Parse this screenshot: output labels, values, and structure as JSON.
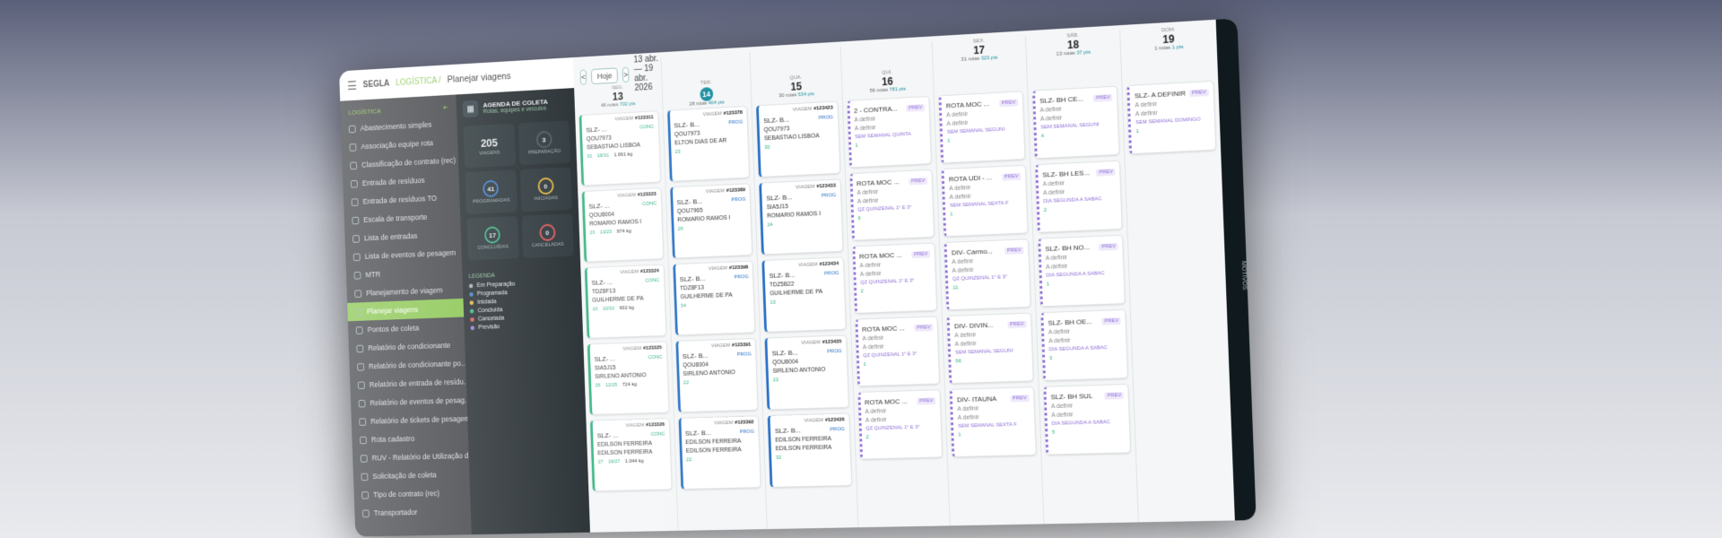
{
  "header": {
    "brand": "SEGLA",
    "module": "LOGÍSTICA /",
    "page": "Planejar viagens"
  },
  "sidebar": {
    "section": "LOGÍSTICA",
    "items": [
      "Abastecimento simples",
      "Associação equipe rota",
      "Classificação de contrato (rec)",
      "Entrada de resíduos",
      "Entrada de resíduos TO",
      "Escala de transporte",
      "Lista de entradas",
      "Lista de eventos de pesagem",
      "MTR",
      "Planejamento de viagem",
      "Planejar viagens",
      "Pontos de coleta",
      "Relatório de condicionante",
      "Relatório de condicionante po...",
      "Relatório de entrada de resídu...",
      "Relatório de eventos de pesag...",
      "Relatório de tickets de pesagem",
      "Rota cadastro",
      "RUV - Relatório de Utilização d...",
      "Solicitação de coleta",
      "Tipo de contrato (rec)",
      "Transportador"
    ]
  },
  "panel": {
    "title": "AGENDA DE COLETA",
    "subtitle": "Rotas, equipes e veículos",
    "stats": {
      "viagens": {
        "value": "205",
        "label": "VIAGENS"
      },
      "preparacao": {
        "value": "3",
        "label": "PREPARAÇÃO"
      },
      "programadas": {
        "value": "41",
        "pct": "20%",
        "label": "PROGRAMADAS"
      },
      "iniciadas": {
        "value": "0",
        "pct": "0%",
        "label": "INICIADAS"
      },
      "concluidas": {
        "value": "17",
        "pct": "8%",
        "label": "CONCLUÍDAS"
      },
      "canceladas": {
        "value": "0",
        "pct": "0%",
        "label": "CANCELADAS"
      }
    },
    "legend_title": "LEGENDA",
    "legend": [
      "Em Preparação",
      "Programada",
      "Iniciada",
      "Concluída",
      "Cancelada",
      "Previsão"
    ],
    "legend_colors": [
      "#9aa3a8",
      "#2b72c8",
      "#e0b12b",
      "#29b07a",
      "#e04848",
      "#8d6fd6"
    ]
  },
  "calendar": {
    "prev": "<",
    "today": "Hoje",
    "next": ">",
    "range": "13 abr. — 19 abr. 2026",
    "days": [
      {
        "w": "SEG.",
        "n": "13",
        "rotas": "46 rotas",
        "pts": "702 pts"
      },
      {
        "w": "TER.",
        "n": "14",
        "rotas": "28 rotas",
        "pts": "404 pts"
      },
      {
        "w": "QUA.",
        "n": "15",
        "rotas": "30 rotas",
        "pts": "534 pts"
      },
      {
        "w": "QUI.",
        "n": "16",
        "rotas": "56 rotas",
        "pts": "781 pts"
      },
      {
        "w": "SEX.",
        "n": "17",
        "rotas": "31 rotas",
        "pts": "323 pts"
      },
      {
        "w": "SÁB.",
        "n": "18",
        "rotas": "13 rotas",
        "pts": "37 pts"
      },
      {
        "w": "DOM.",
        "n": "19",
        "rotas": "1 rotas",
        "pts": "1 pts"
      }
    ],
    "mon": [
      {
        "id": "#123311",
        "route": "SLZ- ...",
        "tag": "CONC",
        "plate": "QOU7973",
        "driver": "SEBASTIÃO LISBOA",
        "f1": "31",
        "f2": "18/31",
        "w": "1.691 kg"
      },
      {
        "id": "#123323",
        "route": "SLZ- ...",
        "tag": "CONC",
        "plate": "QOU8004",
        "driver": "ROMARIO RAMOS I",
        "f1": "23",
        "f2": "13/23",
        "w": "974 kg"
      },
      {
        "id": "#123324",
        "route": "SLZ- ...",
        "tag": "CONC",
        "plate": "TDZ8F13",
        "driver": "GUILHERME DE PA",
        "f1": "10",
        "f2": "10/10",
        "w": "602 kg"
      },
      {
        "id": "#123325",
        "route": "SLZ- ...",
        "tag": "CONC",
        "plate": "SIA5J15",
        "driver": "SIRLENO ANTONIO",
        "f1": "25",
        "f2": "12/25",
        "w": "724 kg"
      },
      {
        "id": "#123326",
        "route": "SLZ- ...",
        "tag": "CONC",
        "plate": "EDILSON FERREIRA",
        "driver": "EDILSON FERREIRA",
        "f1": "27",
        "f2": "19/27",
        "w": "1.044 kg"
      }
    ],
    "tue": [
      {
        "id": "#123378",
        "route": "SLZ- B...",
        "tag": "PROG",
        "plate": "QOU7973",
        "driver": "ELTON DIAS DE AR",
        "f1": "23"
      },
      {
        "id": "#123389",
        "route": "SLZ- B...",
        "tag": "PROG",
        "plate": "QOU7965",
        "driver": "ROMARIO RAMOS I",
        "f1": "20"
      },
      {
        "id": "#123398",
        "route": "SLZ- B...",
        "tag": "PROG",
        "plate": "TDZ8F13",
        "driver": "GUILHERME DE PA",
        "f1": "34"
      },
      {
        "id": "#123391",
        "route": "SLZ- B...",
        "tag": "PROG",
        "plate": "QOU8004",
        "driver": "SIRLENO ANTONIO",
        "f1": "22"
      },
      {
        "id": "#123392",
        "route": "SLZ- B...",
        "tag": "PROG",
        "plate": "EDILSON FERREIRA",
        "driver": "EDILSON FERREIRA",
        "f1": "22"
      }
    ],
    "wed": [
      {
        "id": "#123423",
        "route": "SLZ- B...",
        "tag": "PROG",
        "plate": "QOU7973",
        "driver": "SEBASTIÃO LISBOA",
        "f1": "30"
      },
      {
        "id": "#123433",
        "route": "SLZ- B...",
        "tag": "PROG",
        "plate": "SIA5J15",
        "driver": "ROMARIO RAMOS I",
        "f1": "24"
      },
      {
        "id": "#123434",
        "route": "SLZ- B...",
        "tag": "PROG",
        "plate": "TDZ5B22",
        "driver": "GUILHERME DE PA",
        "f1": "13"
      },
      {
        "id": "#123435",
        "route": "SLZ- B...",
        "tag": "PROG",
        "plate": "QOU8004",
        "driver": "SIRLENO ANTONIO",
        "f1": "23"
      },
      {
        "id": "#123436",
        "route": "SLZ- B...",
        "tag": "PROG",
        "plate": "EDILSON FERREIRA",
        "driver": "EDILSON FERREIRA",
        "f1": "32"
      }
    ],
    "thu": [
      {
        "route": "2 - CONTRA...",
        "tag": "PREV",
        "a": "A definir",
        "b": "A definir",
        "per": "SEM SEMANAL QUINTA",
        "f1": "1"
      },
      {
        "route": "ROTA MOC ...",
        "tag": "PREV",
        "a": "A definir",
        "b": "A definir",
        "per": "QZ QUINZENAL 1º E 3º",
        "f1": "6"
      },
      {
        "route": "ROTA MOC ...",
        "tag": "PREV",
        "a": "A definir",
        "b": "A definir",
        "per": "QZ QUINZENAL 1º E 3º",
        "f1": "2"
      },
      {
        "route": "ROTA MOC ...",
        "tag": "PREV",
        "a": "A definir",
        "b": "A definir",
        "per": "QZ QUINZENAL 1º E 3º",
        "f1": "1"
      },
      {
        "route": "ROTA MOC ...",
        "tag": "PREV",
        "a": "A definir",
        "b": "A definir",
        "per": "QZ QUINZENAL 1º E 3º",
        "f1": "2"
      }
    ],
    "fri": [
      {
        "route": "ROTA MOC ...",
        "tag": "PREV",
        "a": "A definir",
        "b": "A definir",
        "per": "SEM SEMANAL SEGUNI",
        "f1": "1"
      },
      {
        "route": "ROTA UDI - ...",
        "tag": "PREV",
        "a": "A definir",
        "b": "A definir",
        "per": "SEM SEMANAL SEXTA F",
        "f1": "1"
      },
      {
        "route": "DIV- Carmo...",
        "tag": "PREV",
        "a": "A definir",
        "b": "A definir",
        "per": "QZ QUINZENAL 1º E 3º",
        "f1": "11"
      },
      {
        "route": "DIV- DIVIN...",
        "tag": "PREV",
        "a": "A definir",
        "b": "A definir",
        "per": "SEM SEMANAL SEGUNI",
        "f1": "56"
      },
      {
        "route": "DIV- ITAUNA",
        "tag": "PREV",
        "a": "A definir",
        "b": "A definir",
        "per": "SEM SEMANAL SEXTA F",
        "f1": "1"
      }
    ],
    "sat": [
      {
        "route": "SLZ- BH CE...",
        "tag": "PREV",
        "a": "A definir",
        "b": "A definir",
        "per": "SEM SEMANAL SEGUNI",
        "f1": "4"
      },
      {
        "route": "SLZ- BH LES...",
        "tag": "PREV",
        "a": "A definir",
        "b": "A definir",
        "per": "DIA SEGUNDA A SABAC",
        "f1": "2"
      },
      {
        "route": "SLZ- BH NO...",
        "tag": "PREV",
        "a": "A definir",
        "b": "A definir",
        "per": "DIA SEGUNDA A SABAC",
        "f1": "1"
      },
      {
        "route": "SLZ- BH OE...",
        "tag": "PREV",
        "a": "A definir",
        "b": "A definir",
        "per": "DIA SEGUNDA A SABAC",
        "f1": "3"
      },
      {
        "route": "SLZ- BH SUL",
        "tag": "PREV",
        "a": "A definir",
        "b": "A definir",
        "per": "DIA SEGUNDA A SABAC",
        "f1": "5"
      }
    ],
    "sun": [
      {
        "route": "SLZ- A DEFINIR",
        "tag": "PREV",
        "a": "A definir",
        "b": "A definir",
        "per": "SEM SEMANAL DOMINGO",
        "f1": "1"
      }
    ],
    "viagem": "VIAGEM"
  },
  "side_label": "MOTIVOS"
}
